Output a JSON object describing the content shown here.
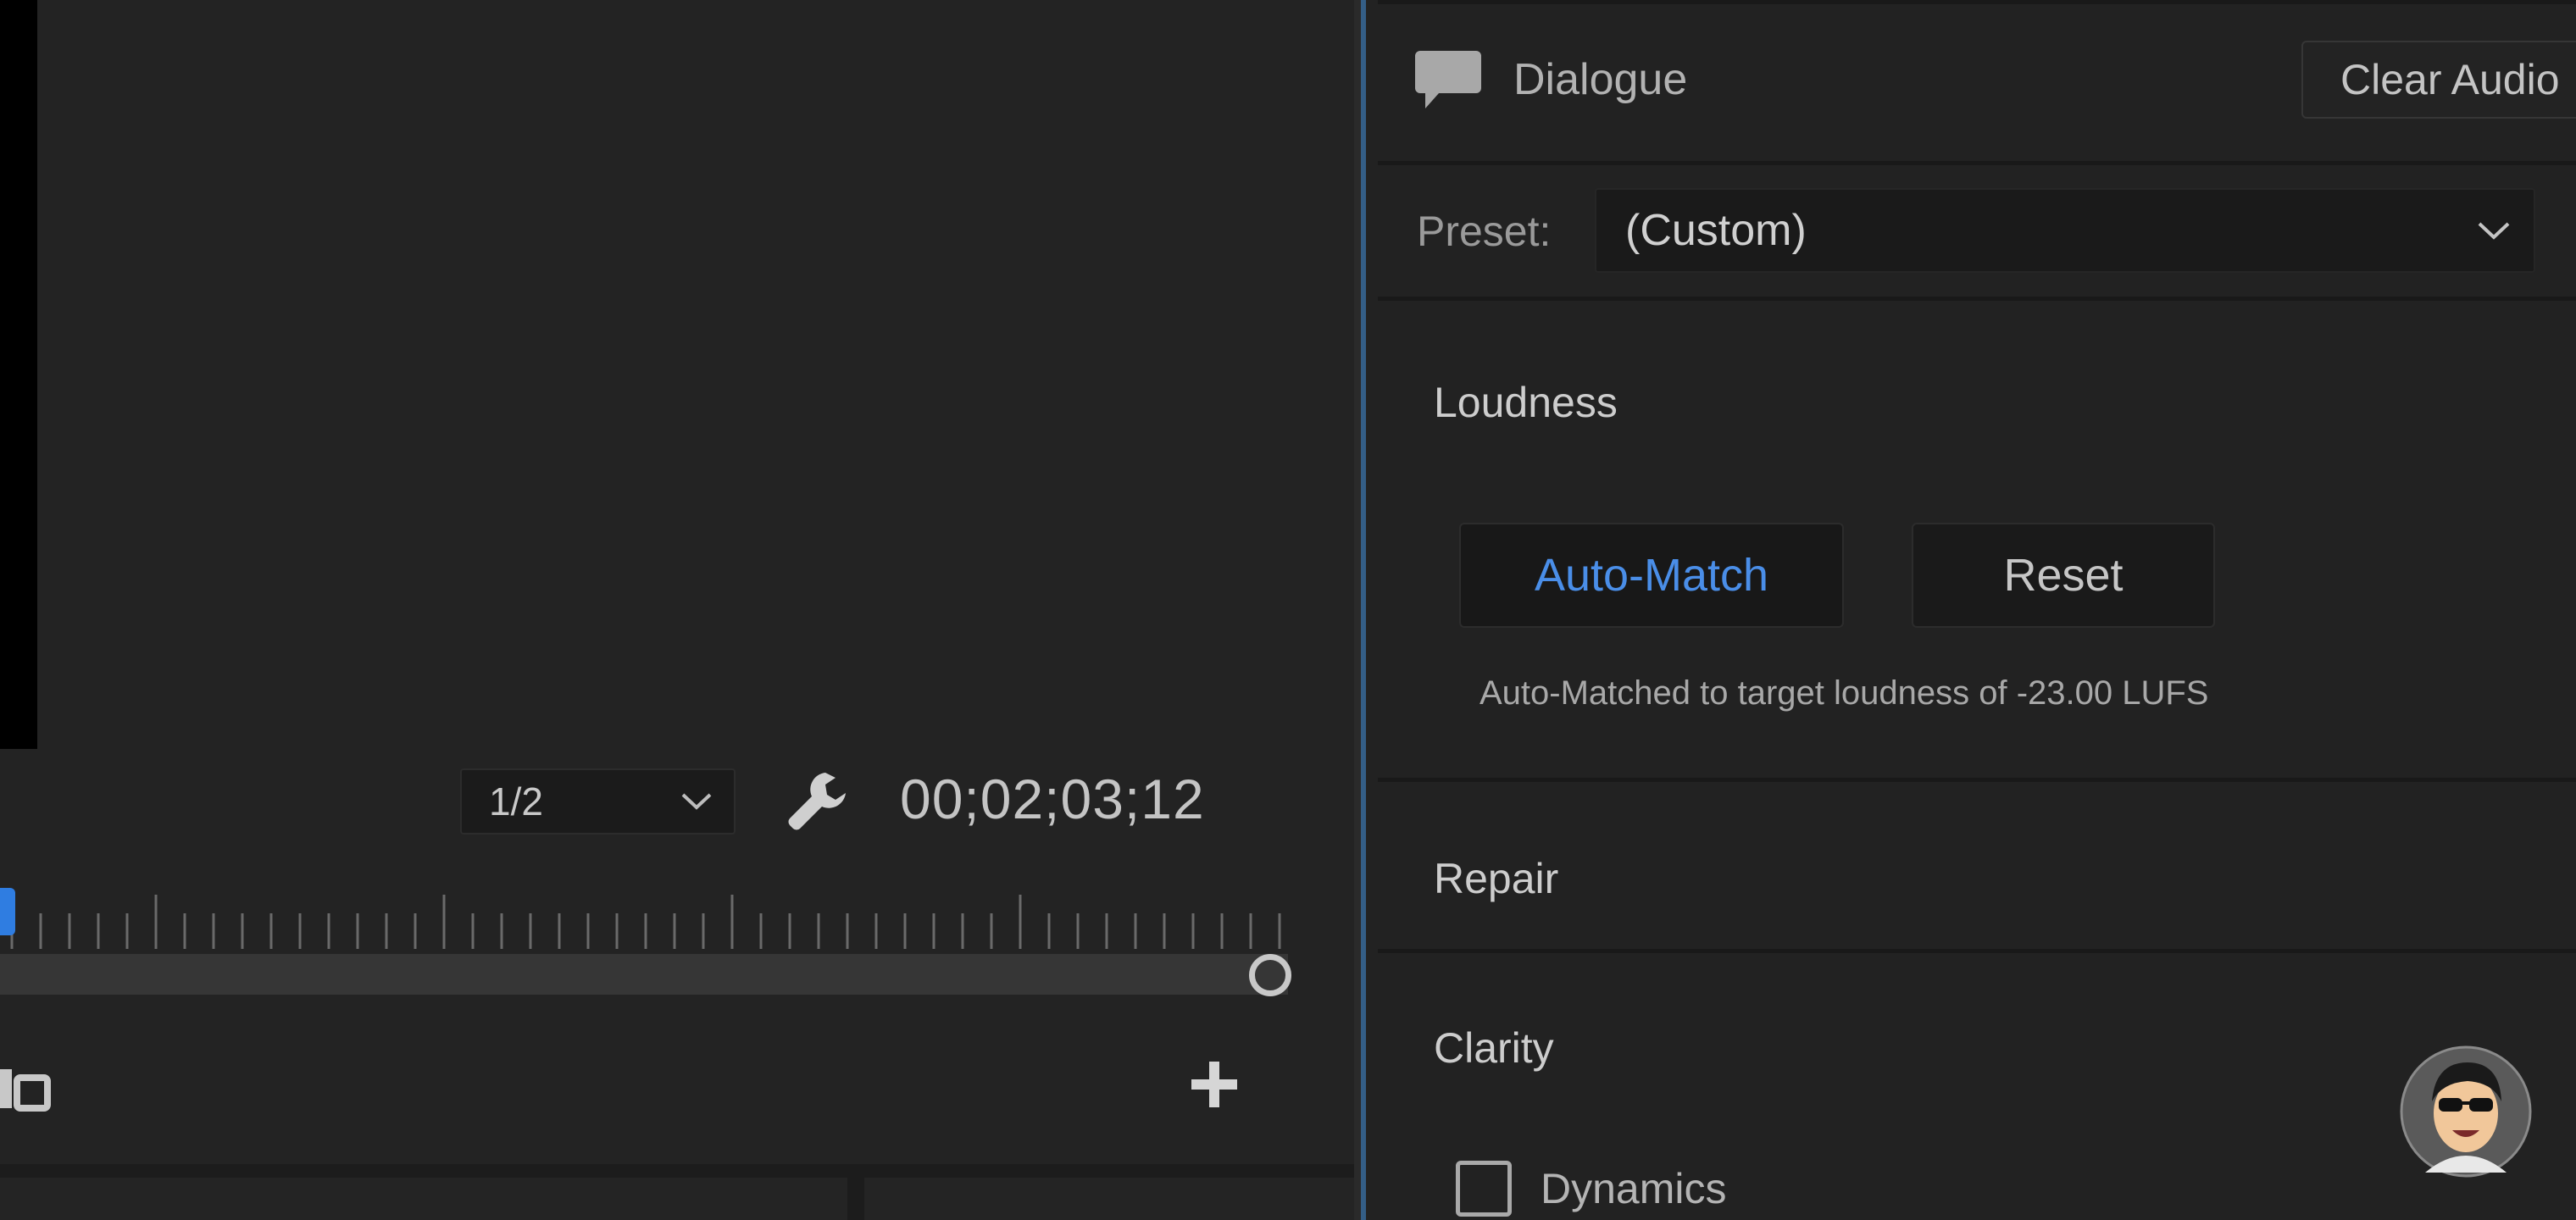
{
  "monitor": {
    "resolution": {
      "selected": "1/2",
      "icon": "chevron-down-icon"
    },
    "settings_icon": "wrench-icon",
    "timecode": "00;02;03;12",
    "add_icon": "plus-icon",
    "export_icon": "export-frame-icon",
    "accent_color": "#2f7de1"
  },
  "essential_sound": {
    "type": {
      "icon": "speech-bubble-icon",
      "label": "Dialogue"
    },
    "clear_audio_label": "Clear Audio",
    "preset": {
      "label": "Preset:",
      "selected": "(Custom)",
      "icon": "chevron-down-icon"
    },
    "loudness": {
      "heading": "Loudness",
      "auto_match_label": "Auto-Match",
      "reset_label": "Reset",
      "status": "Auto-Matched to target loudness of -23.00 LUFS",
      "accent_color": "#4a8ee8"
    },
    "repair": {
      "heading": "Repair"
    },
    "clarity": {
      "heading": "Clarity",
      "dynamics": {
        "label": "Dynamics",
        "checked": false
      }
    }
  }
}
